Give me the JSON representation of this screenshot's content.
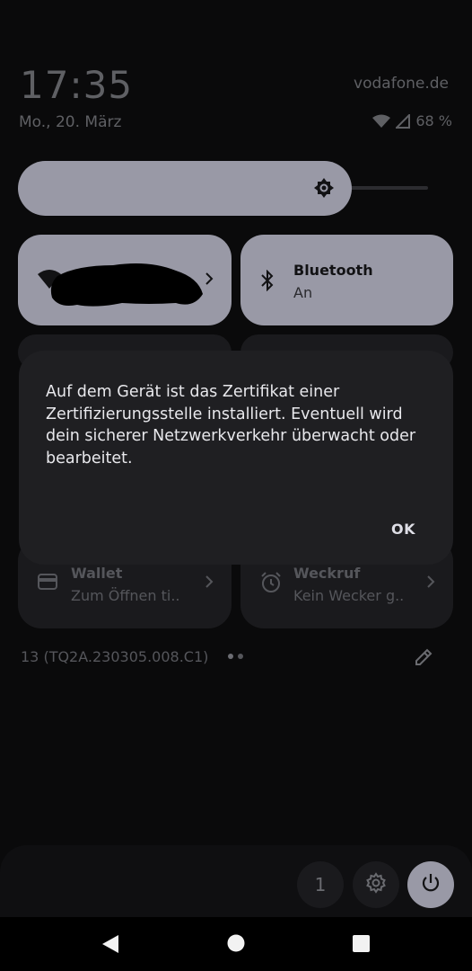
{
  "status": {
    "time": "17:35",
    "date": "Mo., 20. März",
    "carrier": "vodafone.de",
    "battery": "68 %"
  },
  "brightness": {
    "level": 0.76
  },
  "tiles": {
    "internet": {
      "icon": "wifi-icon",
      "label": ""
    },
    "bluetooth": {
      "title": "Bluetooth",
      "subtitle": "An",
      "icon": "bluetooth-icon"
    },
    "wallet": {
      "title": "Wallet",
      "subtitle": "Zum Öffnen ti..",
      "icon": "wallet-icon"
    },
    "alarm": {
      "title": "Weckruf",
      "subtitle": "Kein Wecker g..",
      "icon": "alarm-icon"
    }
  },
  "dialog": {
    "message": "Auf dem Gerät ist das Zertifikat einer Zertifizierungsstelle installiert. Eventuell wird dein sicherer Netzwerkverkehr überwacht oder bearbeitet.",
    "ok_label": "OK"
  },
  "footer": {
    "build": "13 (TQ2A.230305.008.C1)",
    "page_count": 2,
    "current_page": 1
  },
  "bottom": {
    "user_label": "1"
  },
  "colors": {
    "accent": "#9999a6",
    "background": "#0a0a0b",
    "dialog": "#1f1f22"
  }
}
